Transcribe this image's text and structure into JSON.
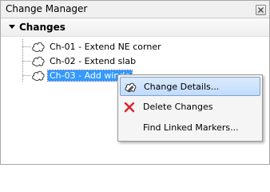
{
  "window": {
    "title": "Change Manager"
  },
  "section": {
    "title": "Changes"
  },
  "changes": [
    {
      "label": "Ch-01 - Extend NE corner",
      "icon": "cloud-markup-icon",
      "selected": false
    },
    {
      "label": "Ch-02 - Extend slab",
      "icon": "cloud-markup-icon",
      "selected": false
    },
    {
      "label": "Ch-03 - Add windo",
      "icon": "cloud-markup-icon",
      "selected": true
    }
  ],
  "context_menu": {
    "items": [
      {
        "label": "Change Details...",
        "icon": "change-details-icon",
        "highlighted": true
      },
      {
        "label": "Delete Changes",
        "icon": "delete-x-icon",
        "highlighted": false
      },
      {
        "label": "Find Linked Markers...",
        "icon": "",
        "highlighted": false
      }
    ]
  },
  "colors": {
    "selection": "#3399ff",
    "menu_highlight": "#c1dbfc",
    "delete_icon": "#d9232d"
  }
}
